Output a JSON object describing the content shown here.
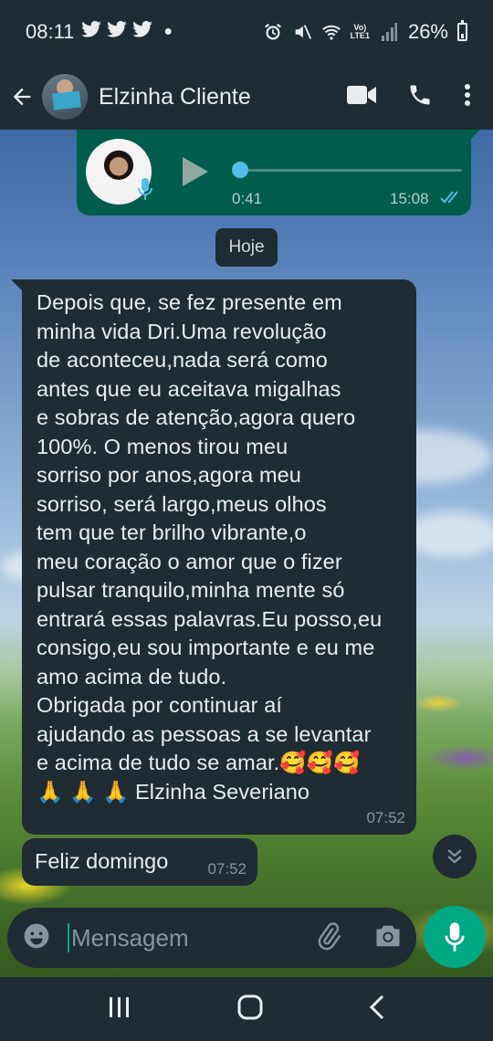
{
  "status_bar": {
    "time": "08:11",
    "volte_line1": "Vo)",
    "volte_line2": "LTE1",
    "battery": "26%"
  },
  "header": {
    "contact_name": "Elzinha Cliente"
  },
  "voice_message": {
    "duration": "0:41",
    "time": "15:08"
  },
  "date_divider": "Hoje",
  "messages": [
    {
      "text": "Depois que, se fez presente em\nminha vida Dri.Uma revolução\nde aconteceu,nada será como\nantes que eu aceitava migalhas\ne sobras de atenção,agora quero\n100%.  O menos  tirou meu\nsorriso por anos,agora meu\nsorriso, será largo,meus olhos\ntem que ter brilho vibrante,o\nmeu coração o amor que o fizer\npulsar tranquilo,minha mente só\nentrará essas palavras.Eu posso,eu\nconsigo,eu sou importante e eu me\namo acima de tudo.\nObrigada por continuar aí\najudando as pessoas a se levantar\ne acima de tudo se amar.🥰🥰🥰\n🙏 🙏 🙏 Elzinha Severiano",
      "time": "07:52"
    },
    {
      "text": "Feliz domingo",
      "time": "07:52"
    }
  ],
  "composer": {
    "placeholder": "Mensagem"
  },
  "colors": {
    "header_bg": "#1f2c34",
    "outgoing_bubble": "#005c4b",
    "incoming_bubble": "#202c33",
    "accent": "#00a884",
    "read_ticks": "#53bdeb"
  }
}
